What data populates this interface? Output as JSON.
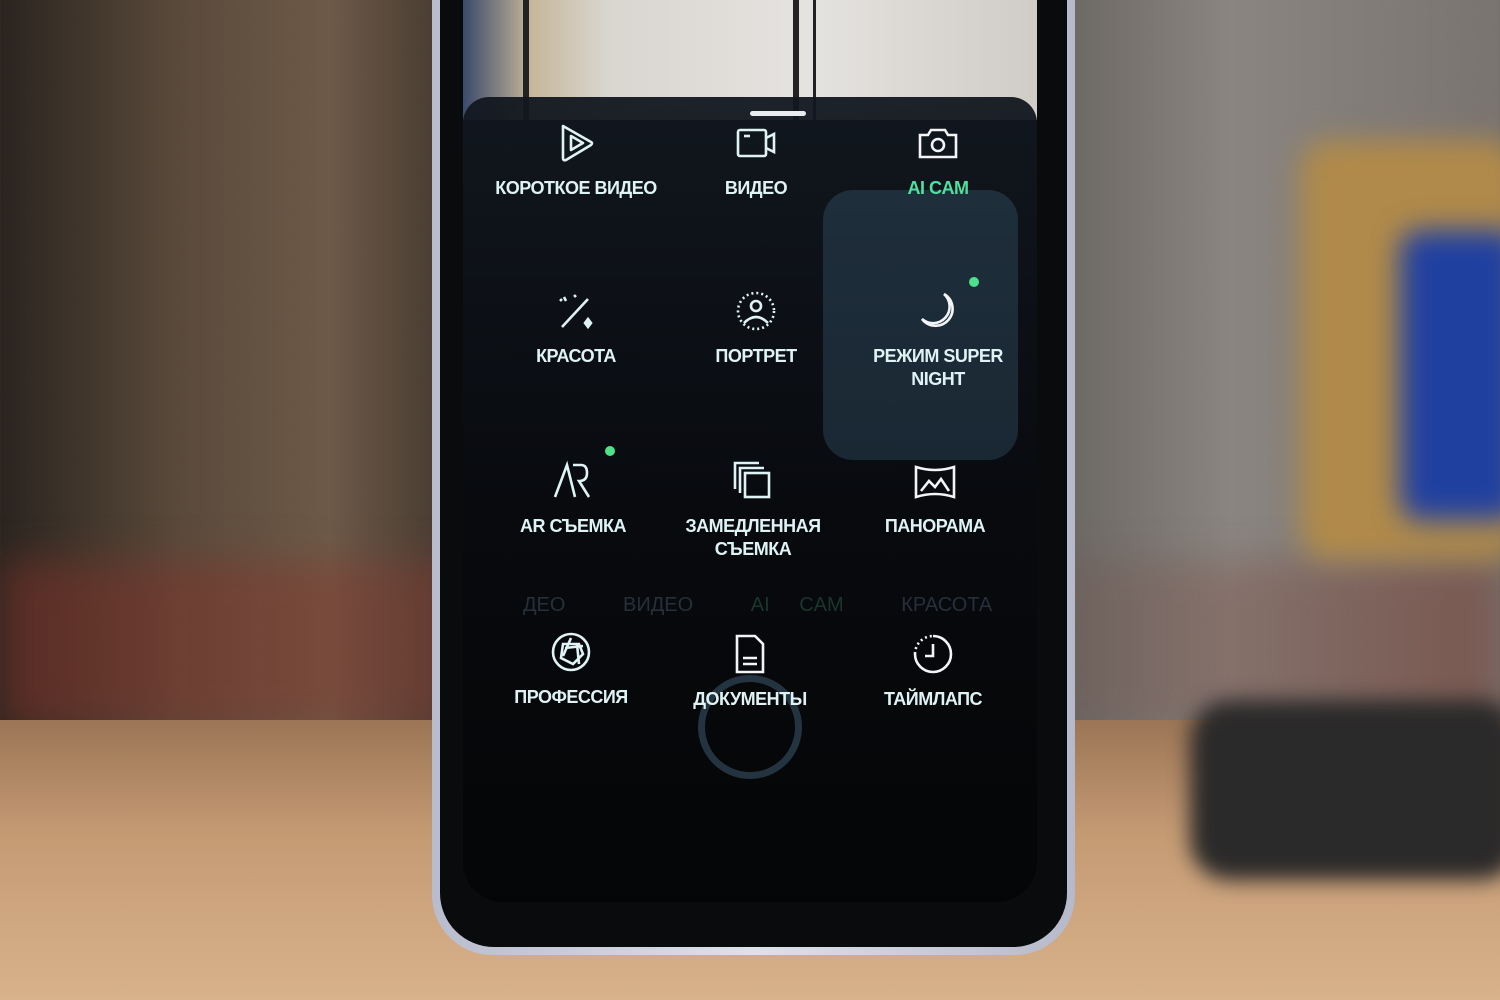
{
  "panel": {
    "modes": [
      {
        "label": "КОРОТКОЕ ВИДЕО",
        "icon": "play-triangle-icon",
        "active": false
      },
      {
        "label": "ВИДЕО",
        "icon": "video-camera-icon",
        "active": false
      },
      {
        "label": "AI CAM",
        "icon": "camera-icon",
        "active": true
      },
      {
        "label": "КРАСОТА",
        "icon": "magic-wand-icon",
        "active": false
      },
      {
        "label": "ПОРТРЕТ",
        "icon": "portrait-icon",
        "active": false,
        "new_badge": false
      },
      {
        "label": "РЕЖИМ SUPER NIGHT",
        "icon": "moon-icon",
        "active": false,
        "new_badge": true
      },
      {
        "label": "AR СЪЕМКА",
        "icon": "ar-icon",
        "active": false,
        "new_badge": true
      },
      {
        "label": "ЗАМЕДЛЕННАЯ СЪЕМКА",
        "icon": "slow-motion-icon",
        "active": false
      },
      {
        "label": "ПАНОРАМА",
        "icon": "panorama-icon",
        "active": false
      },
      {
        "label": "ПРОФЕССИЯ",
        "icon": "aperture-icon",
        "active": false
      },
      {
        "label": "ДОКУМЕНТЫ",
        "icon": "document-icon",
        "active": false
      },
      {
        "label": "ТАЙМЛАПС",
        "icon": "timer-icon",
        "active": false
      }
    ]
  },
  "background_mode_strip": [
    "ДЕО",
    "ВИДЕО",
    "AI CAM",
    "КРАСОТА"
  ],
  "colors": {
    "accent": "#4fe0a0",
    "label": "#dff3f4",
    "badge": "#4fe08a"
  }
}
